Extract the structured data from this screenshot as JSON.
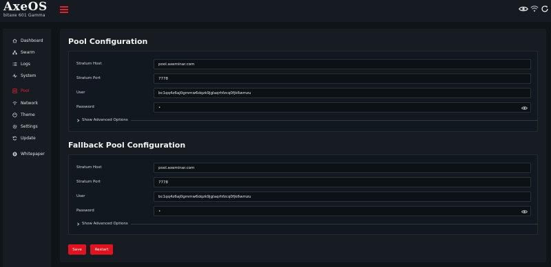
{
  "app": {
    "logo_text": "AxeOS",
    "model": "bitaxe 601 Gamma"
  },
  "sidebar": {
    "items": [
      {
        "label": "Dashboard",
        "icon": "home-icon"
      },
      {
        "label": "Swarm",
        "icon": "sitemap-icon"
      },
      {
        "label": "Logs",
        "icon": "list-icon"
      },
      {
        "label": "System",
        "icon": "pulse-icon"
      },
      {
        "label": "Pool",
        "icon": "server-icon",
        "active": true
      },
      {
        "label": "Network",
        "icon": "wifi-icon"
      },
      {
        "label": "Theme",
        "icon": "palette-icon"
      },
      {
        "label": "Settings",
        "icon": "gear-icon"
      },
      {
        "label": "Update",
        "icon": "refresh-icon"
      },
      {
        "label": "Whitepaper",
        "icon": "bitcoin-icon"
      }
    ]
  },
  "pool": {
    "title": "Pool Configuration",
    "fields": [
      {
        "label": "Stratum Host",
        "value": "pool.axeminar.com"
      },
      {
        "label": "Stratum Port",
        "value": "7778"
      },
      {
        "label": "User",
        "value": "bc1qq4z6aj0gmmw6dqzk9jglaqrhfzcq0fjk6wmzu"
      },
      {
        "label": "Password",
        "value": "•"
      }
    ],
    "advanced_label": "Show Advanced Options"
  },
  "fallback": {
    "title": "Fallback Pool Configuration",
    "fields": [
      {
        "label": "Stratum Host",
        "value": "pool.axeminar.com"
      },
      {
        "label": "Stratum Port",
        "value": "7778"
      },
      {
        "label": "User",
        "value": "bc1qq4z6aj0gmmw6dqzk9jglaqrhfzcq0fjk6wmzu"
      },
      {
        "label": "Password",
        "value": "•"
      }
    ],
    "advanced_label": "Show Advanced Options"
  },
  "actions": {
    "save_label": "Save",
    "restart_label": "Restart"
  },
  "colors": {
    "accent": "#e3232e",
    "background": "#0f1418",
    "panel": "#161c21"
  }
}
